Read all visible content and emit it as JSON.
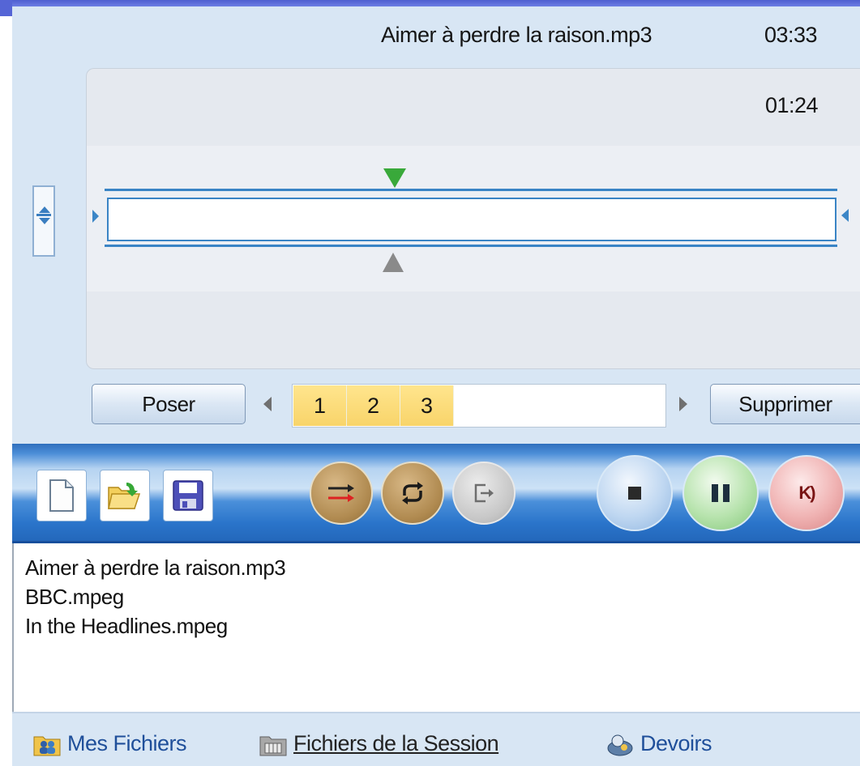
{
  "player": {
    "file_name": "Aimer à perdre la raison.mp3",
    "duration": "03:33",
    "current_time": "01:24",
    "markers": {
      "poser_label": "Poser",
      "supprimer_label": "Supprimer",
      "segments": [
        "1",
        "2",
        "3"
      ]
    }
  },
  "toolbar": {
    "file_buttons": [
      "new-document-icon",
      "open-folder-icon",
      "save-disk-icon"
    ],
    "mode_buttons": [
      "switch-arrows-icon",
      "repeat-icon",
      "export-icon"
    ],
    "transport_buttons": [
      "stop-icon",
      "pause-icon",
      "record-icon"
    ],
    "colors": {
      "mode": "#b08a50",
      "stop": "#bfd7f1",
      "pause": "#b7e3ad",
      "record": "#f0b3b3",
      "segment": "#f8d46a",
      "track": "#3a84c5"
    }
  },
  "file_list": [
    "Aimer à perdre la raison.mp3",
    "BBC.mpeg",
    "In the Headlines.mpeg"
  ],
  "tabs": [
    {
      "label": "Mes Fichiers",
      "icon": "users-folder-icon"
    },
    {
      "label": "Fichiers de la Session",
      "icon": "session-folder-icon"
    },
    {
      "label": "Devoirs",
      "icon": "homework-icon"
    }
  ]
}
